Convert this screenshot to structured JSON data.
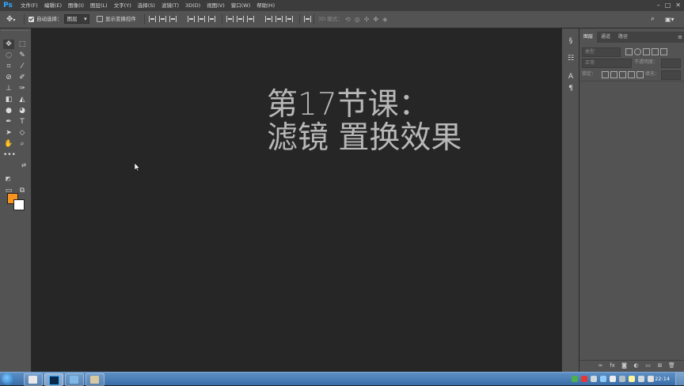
{
  "app": {
    "logo": "Ps"
  },
  "menubar": {
    "items": [
      "文件(F)",
      "编辑(E)",
      "图像(I)",
      "图层(L)",
      "文字(Y)",
      "选择(S)",
      "滤镜(T)",
      "3D(D)",
      "视图(V)",
      "窗口(W)",
      "帮助(H)"
    ],
    "window_controls": [
      "–",
      "□",
      "✕"
    ]
  },
  "options_bar": {
    "tool_icon": "move-tool-icon",
    "auto_select_label": "自动选择：",
    "auto_select_checked": true,
    "auto_select_target": "图层",
    "show_transform_label": "显示变换控件",
    "show_transform_checked": false,
    "mode_3d_label": "3D 模式："
  },
  "tools": [
    "move-tool-icon",
    "artboard-tool-icon",
    "lasso-tool-icon",
    "quick-select-tool-icon",
    "crop-tool-icon",
    "eyedropper-tool-icon",
    "healing-brush-tool-icon",
    "brush-tool-icon",
    "clone-stamp-tool-icon",
    "history-brush-tool-icon",
    "eraser-tool-icon",
    "paint-bucket-tool-icon",
    "blur-tool-icon",
    "dodge-tool-icon",
    "pen-tool-icon",
    "type-tool-icon",
    "path-select-tool-icon",
    "shape-tool-icon",
    "hand-tool-icon",
    "zoom-tool-icon",
    "more-tools-icon"
  ],
  "colors": {
    "foreground": "#f7931e",
    "background": "#ffffff",
    "canvas": "#262626",
    "panel": "#535353",
    "accent": "#31a8ff"
  },
  "canvas": {
    "title_line1": "第17节课：",
    "title_line2": "滤镜 置换效果"
  },
  "right_strip_icons": [
    "history-icon",
    "properties-icon",
    "character-icon",
    "paragraph-icon"
  ],
  "layers_panel": {
    "tabs": [
      "图层",
      "通道",
      "路径"
    ],
    "active_tab": "图层",
    "filter_label": "类型",
    "blend_mode": "正常",
    "opacity_label": "不透明度：",
    "lock_label": "锁定：",
    "fill_label": "填充："
  },
  "taskbar": {
    "clock": "22:14"
  }
}
